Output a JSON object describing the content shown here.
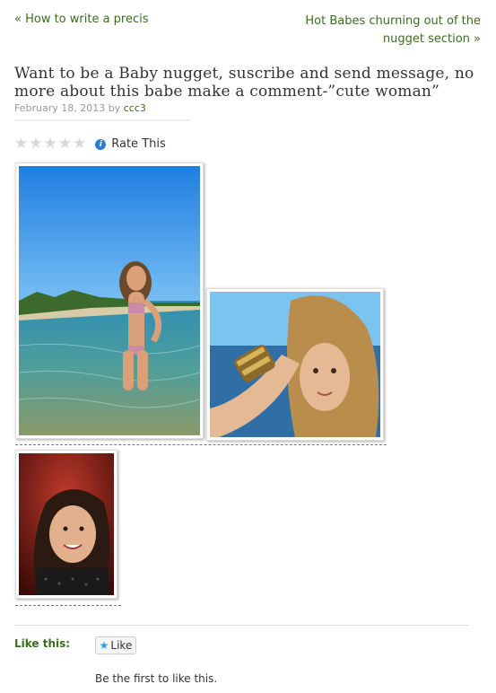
{
  "nav": {
    "prev": "« How to write a precis",
    "next": "Hot Babes churning out of the nugget section »"
  },
  "post": {
    "title": "Want to be a Baby nugget, suscribe and send message, no more about this babe make a comment-”cute woman”",
    "date": "February 18, 2013",
    "by": "by",
    "author": "ccc3"
  },
  "rating": {
    "label": "Rate This",
    "stars_total": 5,
    "stars_filled": 0
  },
  "gallery": {
    "images": [
      {
        "alt": "woman in bikini standing in the sea"
      },
      {
        "alt": "woman with bracelets holding her hair"
      },
      {
        "alt": "smiling woman with dark hair"
      }
    ]
  },
  "like": {
    "label": "Like this:",
    "button": "Like",
    "first": "Be the first to like this."
  },
  "colors": {
    "link": "#3b6d1f",
    "muted": "#999999"
  }
}
